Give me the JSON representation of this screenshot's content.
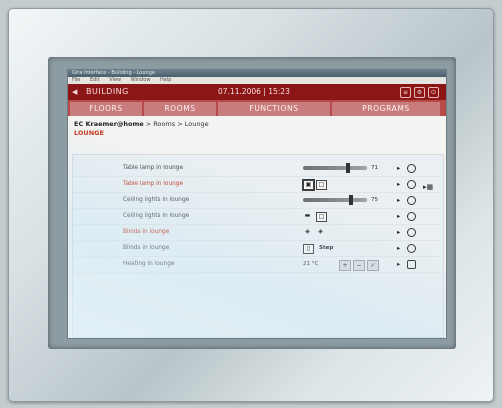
{
  "window": {
    "title": "Gira Interface - Building - Lounge",
    "menu": [
      "File",
      "Edit",
      "View",
      "Window",
      "Help"
    ]
  },
  "topbar": {
    "building_label": "BUILDING",
    "datetime": "07.11.2006 | 15:23"
  },
  "tabs": [
    {
      "label": "FLOORS"
    },
    {
      "label": "ROOMS"
    },
    {
      "label": "FUNCTIONS"
    },
    {
      "label": "PROGRAMS"
    }
  ],
  "breadcrumb": {
    "user": "EC Kraemer@home",
    "path": " > Rooms > Lounge"
  },
  "room_title": "LOUNGE",
  "rows": [
    {
      "label": "Table lamp in lounge",
      "value": "71"
    },
    {
      "label": "Table lamp in lounge"
    },
    {
      "label": "Ceiling lights in lounge",
      "value": "75"
    },
    {
      "label": "Ceiling lights in lounge"
    },
    {
      "label": "Blinds in lounge"
    },
    {
      "label": "Blinds in lounge",
      "value": "Step"
    },
    {
      "label": "Heating in lounge",
      "value": "21 °C"
    }
  ],
  "levels": {
    "dimmer_table_lamp": 0.71,
    "dimmer_ceiling_lights": 0.75
  }
}
